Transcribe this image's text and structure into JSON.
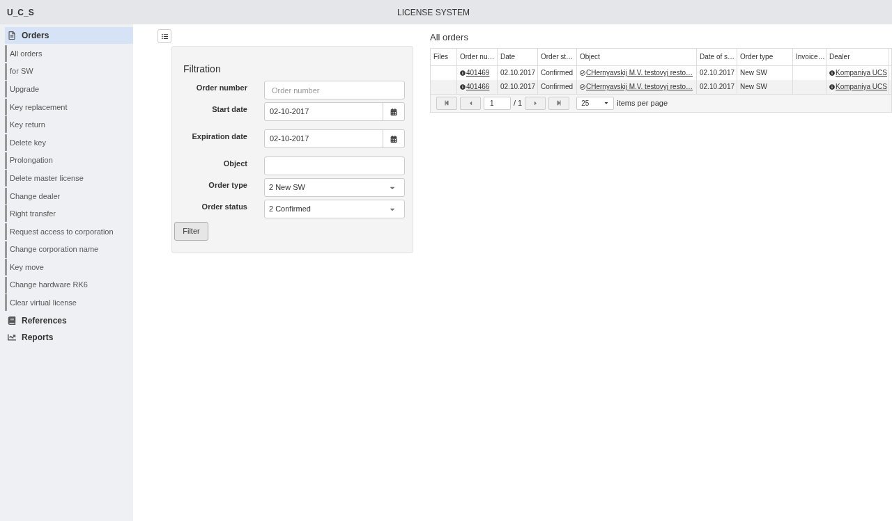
{
  "header": {
    "logo": "U_C_S",
    "title": "LICENSE SYSTEM"
  },
  "sidebar": [
    {
      "label": "Orders",
      "kind": "orders",
      "selected": true,
      "children": [
        {
          "label": "All orders",
          "selected": false
        },
        {
          "label": "for SW",
          "selected": false
        },
        {
          "label": "Upgrade",
          "selected": false
        },
        {
          "label": "Key replacement",
          "selected": false
        },
        {
          "label": "Key return",
          "selected": false
        },
        {
          "label": "Delete key",
          "selected": false
        },
        {
          "label": "Prolongation",
          "selected": false
        },
        {
          "label": "Delete master license",
          "selected": false
        },
        {
          "label": "Change dealer",
          "selected": false
        },
        {
          "label": "Right transfer",
          "selected": false
        },
        {
          "label": "Request access to corporation",
          "selected": false
        },
        {
          "label": "Change corporation name",
          "selected": false
        },
        {
          "label": "Key move",
          "selected": false
        },
        {
          "label": "Change hardware RK6",
          "selected": false
        },
        {
          "label": "Clear virtual license",
          "selected": false
        }
      ]
    },
    {
      "label": "References",
      "kind": "book",
      "selected": false
    },
    {
      "label": "Reports",
      "kind": "chart",
      "selected": false
    }
  ],
  "filter": {
    "title": "Filtration",
    "fields": [
      {
        "label": "Order number",
        "kind": "text",
        "placeholder": "Order number"
      },
      {
        "label": "Start date",
        "kind": "date",
        "value": "02-10-2017"
      },
      {
        "label": "Expiration date",
        "kind": "date",
        "value": "02-10-2017"
      },
      {
        "label": "Object",
        "kind": "text"
      },
      {
        "label": "Order type",
        "kind": "select",
        "value": "2 New SW"
      },
      {
        "label": "Order status",
        "kind": "select",
        "value": "2 Confirmed"
      }
    ],
    "button": "Filter"
  },
  "orders": {
    "title": "All orders",
    "columns": [
      "Files",
      "Order nu…",
      "Date",
      "Order st…",
      "Object",
      "Date of s…",
      "Order type",
      "Invoice…",
      "Dealer"
    ],
    "rows": [
      {
        "files": "",
        "order_number": "401469",
        "date": "02.10.2017",
        "status": "Confirmed",
        "object": "CHernyavskij M.V. testovyj resto…",
        "date_of_s": "02.10.2017",
        "order_type": "New SW",
        "invoice": "",
        "dealer": "Kompaniya UCS"
      },
      {
        "files": "",
        "order_number": "401466",
        "date": "02.10.2017",
        "status": "Confirmed",
        "object": "CHernyavskij M.V. testovyj resto…",
        "date_of_s": "02.10.2017",
        "order_type": "New SW",
        "invoice": "",
        "dealer": "Kompaniya UCS"
      }
    ],
    "pager": {
      "page": "1",
      "total": "/ 1",
      "page_size": "25",
      "page_size_label": "items per page"
    }
  }
}
